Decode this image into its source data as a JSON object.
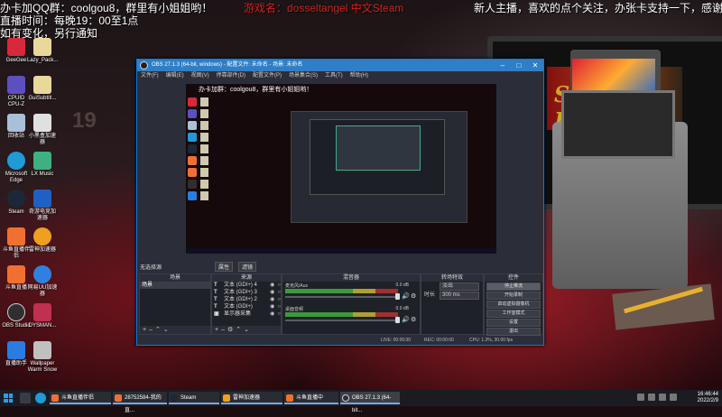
{
  "overlay": {
    "line1_a": "办卡加QQ群：coolgou8，群里有小姐姐哟！",
    "line1_b": "游戏名：dosseltangel  中文Steam",
    "line1_c": "新人主播，喜欢的点个关注，办张卡支持一下，感谢",
    "line2": "直播时间：每晚19：00至1点",
    "line3": "如有变化，另行通知"
  },
  "desktop_icons": [
    {
      "label": "GeeGee",
      "color": "#d8283c",
      "icon": "app-icon"
    },
    {
      "label": "Lazy_Pack...",
      "color": "#e8d89a",
      "icon": "file-icon"
    },
    {
      "label": "CPUID CPU-Z",
      "color": "#5c4fc0",
      "icon": "cpu-icon"
    },
    {
      "label": "GuiSubtitl...",
      "color": "#e8d89a",
      "icon": "file-icon"
    },
    {
      "label": "回收站",
      "color": "#a8c0d8",
      "icon": "recycle-bin-icon"
    },
    {
      "label": "小黑盒加速器",
      "color": "#e0e0e0",
      "icon": "app-icon"
    },
    {
      "label": "Microsoft Edge",
      "color": "#1f9bd8",
      "icon": "edge-icon"
    },
    {
      "label": "LX Music",
      "color": "#40b080",
      "icon": "music-icon"
    },
    {
      "label": "Steam",
      "color": "#1b2838",
      "icon": "steam-icon"
    },
    {
      "label": "奇游电竞加速器",
      "color": "#2060c0",
      "icon": "app-icon"
    },
    {
      "label": "斗鱼直播伴侣",
      "color": "#f07030",
      "icon": "app-icon"
    },
    {
      "label": "雷神加速器",
      "color": "#f0a020",
      "icon": "app-icon"
    },
    {
      "label": "斗鱼直播",
      "color": "#f07030",
      "icon": "app-icon"
    },
    {
      "label": "网易UU加速器",
      "color": "#3080e0",
      "icon": "app-icon"
    },
    {
      "label": "OBS Studio",
      "color": "#302e31",
      "icon": "obs-icon"
    },
    {
      "label": "DYSMAN...",
      "color": "#c03050",
      "icon": "app-icon"
    },
    {
      "label": "直播助手",
      "color": "#2a7ce0",
      "icon": "app-icon"
    },
    {
      "label": "Wallpaper Warm Snow",
      "color": "#c0c0c0",
      "icon": "wallpaper-icon"
    }
  ],
  "obs": {
    "title": "OBS 27.1.3 (64-bit, windows) - 配置文件: 未命名 - 场景: 未命名",
    "menu": [
      "文件(F)",
      "编辑(E)",
      "视图(V)",
      "停靠部件(D)",
      "配置文件(P)",
      "场景集合(S)",
      "工具(T)",
      "帮助(H)"
    ],
    "preview_text": "办卡加群：coolgou8，群里有小姐姐哟！",
    "scene_bar_label": "无选择源",
    "scene_bar_props": "属性",
    "scene_bar_filters": "滤镜",
    "scenes_header": "场景",
    "sources_header": "来源",
    "mixer_header": "混音器",
    "transitions_header": "转场特效",
    "controls_header": "控件",
    "scenes": [
      "场景"
    ],
    "sources": [
      "文本 (GDI+) 4",
      "文本 (GDI+) 3",
      "文本 (GDI+) 2",
      "文本 (GDI+)",
      "显示器采集"
    ],
    "mixer": [
      {
        "name": "麦克风/Aux",
        "db": "0.0 dB"
      },
      {
        "name": "桌面音频",
        "db": "0.0 dB"
      }
    ],
    "transition_label": "淡出",
    "duration_label": "时长",
    "duration_value": "300 ms",
    "controls": [
      "停止推流",
      "开始录制",
      "启动虚拟摄像机",
      "工作室模式",
      "设置",
      "退出"
    ],
    "status": {
      "live": "LIVE: 00:00:00",
      "rec": "REC: 00:00:00",
      "cpu": "CPU: 1.3%, 30.00 fps"
    }
  },
  "taskbar": {
    "items": [
      {
        "label": "斗鱼直播伴侣",
        "color": "#f07030"
      },
      {
        "label": "28752584-我的直...",
        "color": "#f07030"
      },
      {
        "label": "Steam",
        "color": "#1b2838"
      },
      {
        "label": "雷神加速器",
        "color": "#f0a020"
      },
      {
        "label": "斗鱼直播中",
        "color": "#f07030"
      },
      {
        "label": "OBS 27.1.3 (64-bit...",
        "color": "#302e31"
      }
    ],
    "time": "16:46:44",
    "date": "2022/2/9"
  }
}
